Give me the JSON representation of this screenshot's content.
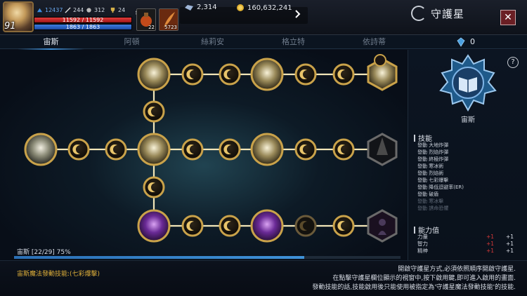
{
  "player": {
    "level": "91",
    "stat_power": "12437",
    "stat_a": "244",
    "stat_b": "312",
    "stat_c": "24",
    "hp": "11592 / 11592",
    "mp": "1863 / 1863"
  },
  "buffs": [
    {
      "count": "22"
    },
    {
      "count": "5723"
    }
  ],
  "currency": {
    "crystal": "2,314",
    "gold": "160,632,241"
  },
  "window": {
    "title": "守護星",
    "close": "✕"
  },
  "tabs": [
    {
      "label": "宙斯",
      "active": true
    },
    {
      "label": "阿頓",
      "active": false
    },
    {
      "label": "絲莉安",
      "active": false
    },
    {
      "label": "格立特",
      "active": false
    },
    {
      "label": "依詩蒂",
      "active": false
    }
  ],
  "crystal_points": "0",
  "constellation": {
    "progress_label": "宙斯 [22/29] 75%",
    "progress_pct": 0.75
  },
  "emblem": {
    "name": "宙斯",
    "help": "?"
  },
  "skills": {
    "header": "技能",
    "items": [
      {
        "text": "發動 大地炸彈",
        "active": true
      },
      {
        "text": "發動 烈焰炸彈",
        "active": true
      },
      {
        "text": "發動 終極炸彈",
        "active": true
      },
      {
        "text": "發動 寒冰術",
        "active": true
      },
      {
        "text": "發動 烈焰術",
        "active": true
      },
      {
        "text": "發動 七彩爆擊",
        "active": true
      },
      {
        "text": "發動 降低迴避率(ER)",
        "active": true
      },
      {
        "text": "發動 破盾",
        "active": true
      },
      {
        "text": "發動 寒冰擊",
        "active": false
      },
      {
        "text": "發動 誘命恐懼",
        "active": false
      }
    ]
  },
  "attributes": {
    "header": "能力值",
    "rows": [
      {
        "name": "力量",
        "red": "+1",
        "white": "+1"
      },
      {
        "name": "智力",
        "red": "+1",
        "white": "+1"
      },
      {
        "name": "精神",
        "red": "+1",
        "white": "+1"
      }
    ]
  },
  "footer": {
    "left": "宙斯魔法發動技能:(七彩爆擊)",
    "right_lines": [
      "開啟守護星方式,必須依照順序開啟守護星.",
      "在點擊守護星欄位顯示的視窗中,按下啟用鍵,即可進入啟用的畫面.",
      "發動技能的話,技能啟用後只能使用被指定為'守護星魔法發動技能'的技能."
    ]
  },
  "colors": {
    "gold": "#c9a24a",
    "accent_blue": "#3f8fd6",
    "hp_red": "#e23b3b",
    "mp_blue": "#3d7de0",
    "footer_gold": "#e0b03a"
  }
}
